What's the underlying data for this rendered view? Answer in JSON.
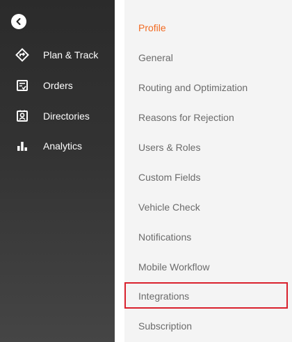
{
  "colors": {
    "accent": "#f26a21",
    "highlight": "#d9202c",
    "nav_bg": "#333333",
    "submenu_bg": "#f4f4f4",
    "submenu_text": "#6b6b6b"
  },
  "leftnav": {
    "collapse_icon": "chevron-left-icon",
    "items": [
      {
        "label": "Plan & Track",
        "icon": "route-diamond-icon"
      },
      {
        "label": "Orders",
        "icon": "order-check-icon"
      },
      {
        "label": "Directories",
        "icon": "contact-card-icon"
      },
      {
        "label": "Analytics",
        "icon": "bar-chart-icon"
      }
    ]
  },
  "submenu": {
    "items": [
      {
        "label": "Profile",
        "active": true
      },
      {
        "label": "General"
      },
      {
        "label": "Routing and Optimization"
      },
      {
        "label": "Reasons for Rejection"
      },
      {
        "label": "Users & Roles"
      },
      {
        "label": "Custom Fields"
      },
      {
        "label": "Vehicle Check"
      },
      {
        "label": "Notifications"
      },
      {
        "label": "Mobile Workflow"
      },
      {
        "label": "Integrations",
        "highlighted": true
      },
      {
        "label": "Subscription"
      }
    ]
  }
}
